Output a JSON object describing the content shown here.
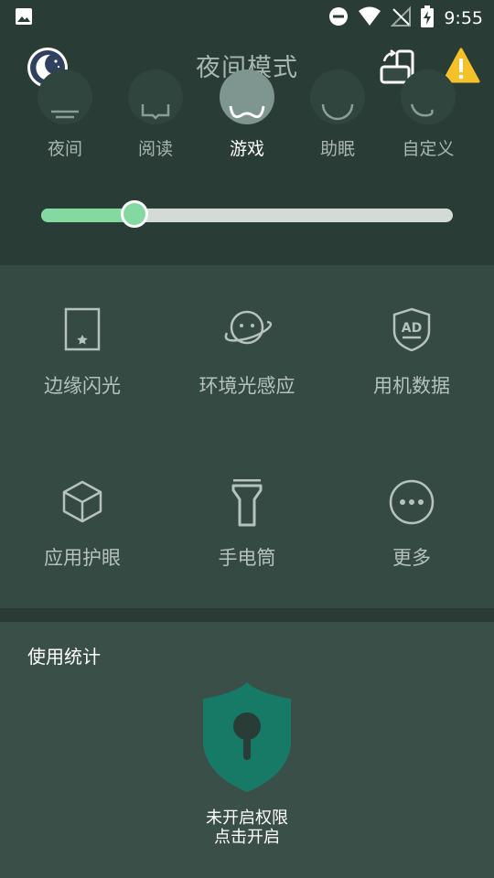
{
  "status_bar": {
    "time": "9:55",
    "icons": [
      "image-icon",
      "dnd-icon",
      "wifi-icon",
      "no-signal-icon",
      "battery-charging-icon"
    ]
  },
  "header": {
    "title": "夜间模式",
    "left_icon": "moon-icon",
    "right_icons": [
      "screen-rotate-icon",
      "warning-icon"
    ]
  },
  "modes": {
    "items": [
      {
        "label": "夜间",
        "icon": "lines-icon"
      },
      {
        "label": "阅读",
        "icon": "book-icon"
      },
      {
        "label": "游戏",
        "icon": "gamepad-icon",
        "selected": true
      },
      {
        "label": "助眠",
        "icon": "moon-circle-icon"
      },
      {
        "label": "自定义",
        "icon": "palette-icon"
      }
    ]
  },
  "intensity": {
    "value": 0.12,
    "min": 0,
    "max": 1
  },
  "tools": {
    "items": [
      {
        "label": "边缘闪光",
        "icon": "edge-flash-icon"
      },
      {
        "label": "环境光感应",
        "icon": "planet-icon"
      },
      {
        "label": "用机数据",
        "icon": "ad-shield-icon"
      },
      {
        "label": "应用护眼",
        "icon": "cube-icon"
      },
      {
        "label": "手电筒",
        "icon": "flashlight-icon"
      },
      {
        "label": "更多",
        "icon": "more-icon"
      }
    ]
  },
  "stats": {
    "title": "使用统计",
    "icon": "lock-shield-icon",
    "line1": "未开启权限",
    "line2": "点击开启"
  },
  "colors": {
    "background": "#2a3c36",
    "panel": "#344a42",
    "stats_panel": "#3b4f49",
    "accent": "#84d9a1",
    "shield": "#167a66",
    "warning": "#f4c228"
  }
}
